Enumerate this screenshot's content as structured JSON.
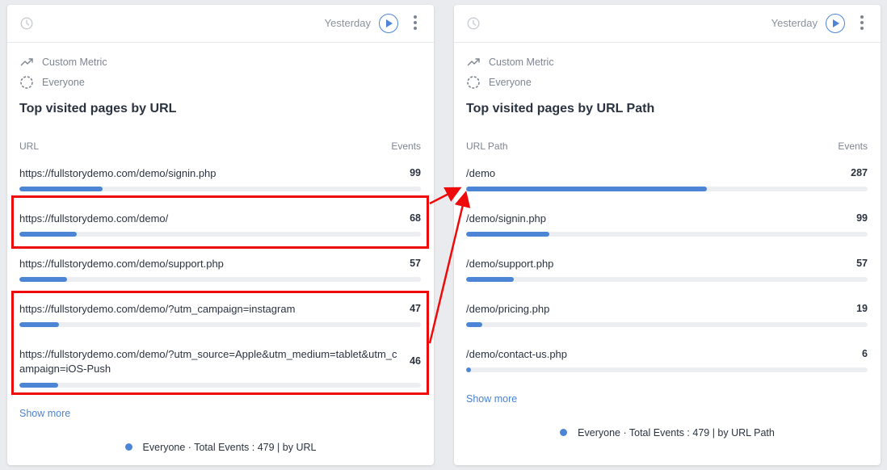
{
  "left_card": {
    "date_label": "Yesterday",
    "metric_label": "Custom Metric",
    "segment_label": "Everyone",
    "title": "Top visited pages by URL",
    "col_label": "URL",
    "col_value": "Events",
    "rows": [
      {
        "label": "https://fullstorydemo.com/demo/signin.php",
        "value": "99",
        "share": 0.207
      },
      {
        "label": "https://fullstorydemo.com/demo/",
        "value": "68",
        "share": 0.142
      },
      {
        "label": "https://fullstorydemo.com/demo/support.php",
        "value": "57",
        "share": 0.119
      },
      {
        "label": "https://fullstorydemo.com/demo/?utm_campaign=instagram",
        "value": "47",
        "share": 0.098
      },
      {
        "label": "https://fullstorydemo.com/demo/?utm_source=Apple&utm_medium=tablet&utm_campaign=iOS-Push",
        "value": "46",
        "share": 0.096
      }
    ],
    "show_more": "Show more",
    "legend": "Everyone · Total Events : 479 | by URL"
  },
  "right_card": {
    "date_label": "Yesterday",
    "metric_label": "Custom Metric",
    "segment_label": "Everyone",
    "title": "Top visited pages by URL Path",
    "col_label": "URL Path",
    "col_value": "Events",
    "rows": [
      {
        "label": "/demo",
        "value": "287",
        "share": 0.599
      },
      {
        "label": "/demo/signin.php",
        "value": "99",
        "share": 0.207
      },
      {
        "label": "/demo/support.php",
        "value": "57",
        "share": 0.119
      },
      {
        "label": "/demo/pricing.php",
        "value": "19",
        "share": 0.04
      },
      {
        "label": "/demo/contact-us.php",
        "value": "6",
        "share": 0.013
      }
    ],
    "show_more": "Show more",
    "legend": "Everyone · Total Events : 479 | by URL Path"
  },
  "colors": {
    "accent": "#4d85d6",
    "highlight": "#ee0a0a",
    "link": "#4a83d4"
  },
  "icons": {
    "clock": "clock-icon",
    "play": "play-icon",
    "more": "more-vertical-icon",
    "metric": "trending-up-icon",
    "segment": "segment-circle-icon"
  }
}
